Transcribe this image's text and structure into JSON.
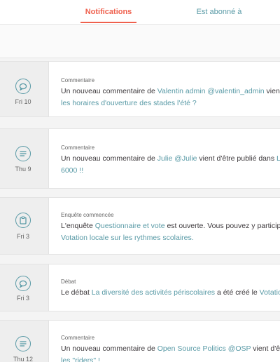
{
  "tabs": {
    "notifications": "Notifications",
    "subscribed": "Est abonné à"
  },
  "colors": {
    "accent": "#ef604d",
    "link": "#599aa6",
    "text": "#3d393c"
  },
  "cards": [
    {
      "icon": "comment-bubble-icon",
      "date": "Fri 10",
      "type": "Commentaire",
      "l1a": "Un nouveau commentaire de ",
      "l1b": "Valentin admin @valentin_admin",
      "l1c": " vient",
      "l2a": "les horaires d'ouverture des stades l'été ?"
    },
    {
      "icon": "text-lines-icon",
      "date": "Thu 9",
      "type": "Commentaire",
      "l1a": "Un nouveau commentaire de ",
      "l1b": "Julie @Julie",
      "l1c": " vient d'être publié dans ",
      "l1d": "L",
      "l2a": "6000 !!"
    },
    {
      "icon": "clipboard-icon",
      "date": "Fri 3",
      "type": "Enquête commencée",
      "l1a": "L'enquête ",
      "l1b": "Questionnaire et vote",
      "l1c": " est ouverte. Vous pouvez y particip",
      "l2a": "Votation locale sur les rythmes scolaires."
    },
    {
      "icon": "comment-bubble-icon",
      "date": "Fri 3",
      "type": "Débat",
      "l1a": "Le débat ",
      "l1b": "La diversité des activités périscolaires",
      "l1c": " a été créé le ",
      "l1d": "Votatio"
    },
    {
      "icon": "text-lines-icon",
      "date": "Thu 12",
      "type": "Commentaire",
      "l1a": "Un nouveau commentaire de ",
      "l1b": "Open Source Politics @OSP",
      "l1c": " vient d'ê",
      "l2a": "les \"riders\" !"
    }
  ]
}
